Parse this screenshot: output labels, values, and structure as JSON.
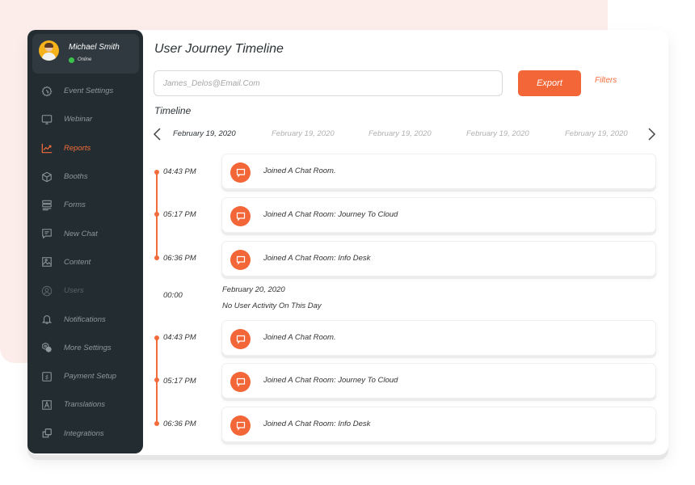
{
  "user": {
    "name": "Michael Smith",
    "status": "Online",
    "status_color": "#3cc14b"
  },
  "sidebar": {
    "items": [
      {
        "label": "Event Settings",
        "icon": "gear-icon",
        "state": "normal"
      },
      {
        "label": "Webinar",
        "icon": "monitor-icon",
        "state": "normal"
      },
      {
        "label": "Reports",
        "icon": "chart-icon",
        "state": "active"
      },
      {
        "label": "Booths",
        "icon": "cube-icon",
        "state": "normal"
      },
      {
        "label": "Forms",
        "icon": "forms-icon",
        "state": "normal"
      },
      {
        "label": "New Chat",
        "icon": "chat-icon",
        "state": "normal"
      },
      {
        "label": "Content",
        "icon": "image-icon",
        "state": "normal"
      },
      {
        "label": "Users",
        "icon": "user-icon",
        "state": "dim"
      },
      {
        "label": "Notifications",
        "icon": "bell-icon",
        "state": "normal"
      },
      {
        "label": "More Settings",
        "icon": "settings-cog-icon",
        "state": "normal"
      },
      {
        "label": "Payment Setup",
        "icon": "dollar-icon",
        "state": "normal"
      },
      {
        "label": "Translations",
        "icon": "translate-icon",
        "state": "normal"
      },
      {
        "label": "Integrations",
        "icon": "integrations-icon",
        "state": "normal"
      }
    ]
  },
  "header": {
    "title": "User Journey Timeline",
    "search_placeholder": "James_Delos@Email.Com",
    "search_value": "",
    "export_label": "Export",
    "filters_label": "Filters"
  },
  "timeline": {
    "section_label": "Timeline",
    "dates": [
      "February 19, 2020",
      "February 19, 2020",
      "February 19, 2020",
      "February 19, 2020",
      "February 19, 2020"
    ],
    "active_date_index": 0,
    "groups": [
      {
        "events": [
          {
            "time": "04:43 PM",
            "text": "Joined A Chat Room."
          },
          {
            "time": "05:17 PM",
            "text": "Joined A Chat Room: Journey To Cloud"
          },
          {
            "time": "06:36 PM",
            "text": "Joined A Chat Room: Info Desk"
          }
        ]
      },
      {
        "empty_day": {
          "time": "00:00",
          "date": "February 20, 2020",
          "message": "No User Activity On This Day"
        }
      },
      {
        "events": [
          {
            "time": "04:43 PM",
            "text": "Joined A Chat Room."
          },
          {
            "time": "05:17 PM",
            "text": "Joined A Chat Room: Journey To Cloud"
          },
          {
            "time": "06:36 PM",
            "text": "Joined A Chat Room: Info Desk"
          }
        ]
      }
    ]
  },
  "colors": {
    "accent": "#f26637",
    "sidebar_bg": "#232c31",
    "background_accent": "#fdedea"
  }
}
